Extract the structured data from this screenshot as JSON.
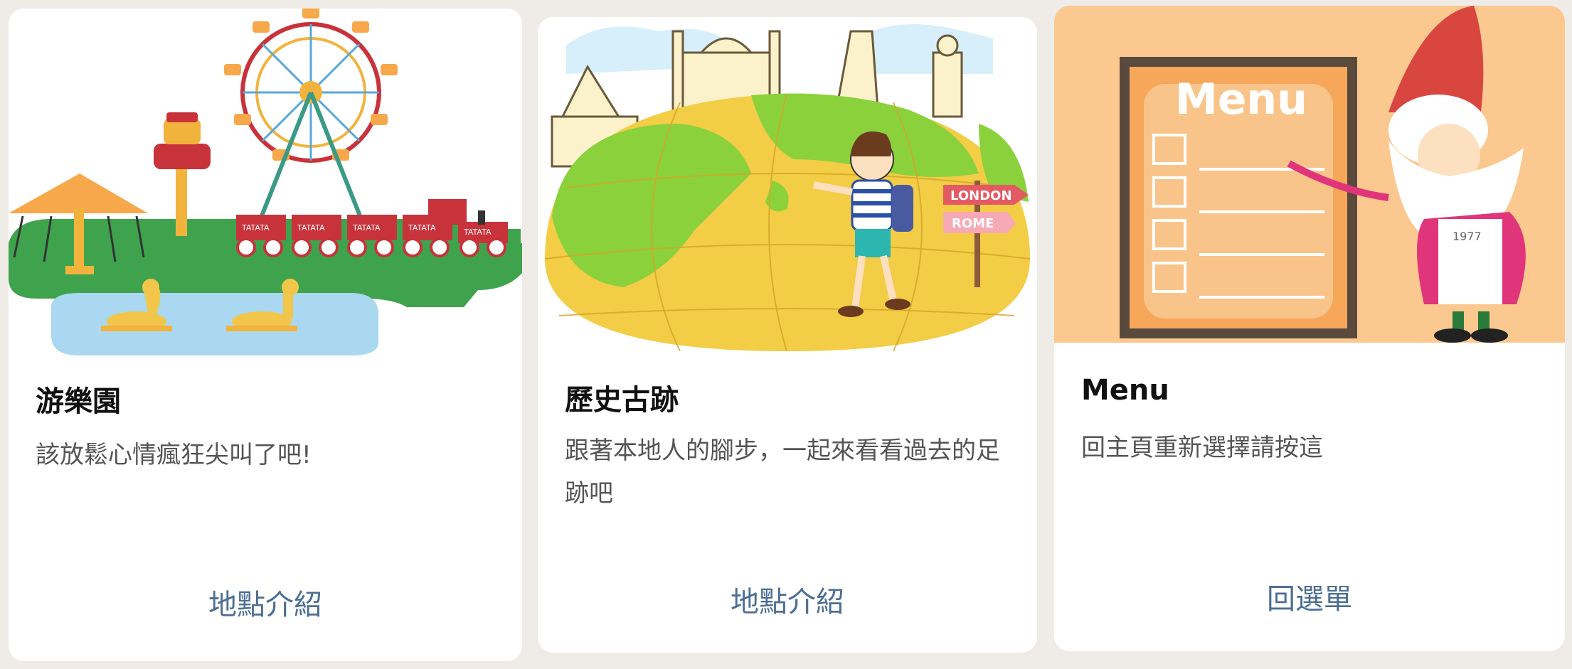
{
  "cards": [
    {
      "title": "游樂園",
      "description": "該放鬆心情瘋狂尖叫了吧!",
      "action_label": "地點介紹",
      "image_text": [
        "TATATA",
        "TATATA",
        "TATATA",
        "TATATA",
        "TATATA"
      ]
    },
    {
      "title": "歷史古跡",
      "description": "跟著本地人的腳步，一起來看看過去的足跡吧",
      "action_label": "地點介紹",
      "image_text": [
        "LONDON",
        "ROME"
      ]
    },
    {
      "title": "Menu",
      "description": "回主頁重新選擇請按這",
      "action_label": "回選單",
      "image_text": [
        "Menu",
        "1977"
      ]
    }
  ],
  "colors": {
    "background": "#efebe6",
    "card": "#ffffff",
    "action_link": "#4d6f93",
    "menu_hero_bg": "#fbc88f"
  }
}
